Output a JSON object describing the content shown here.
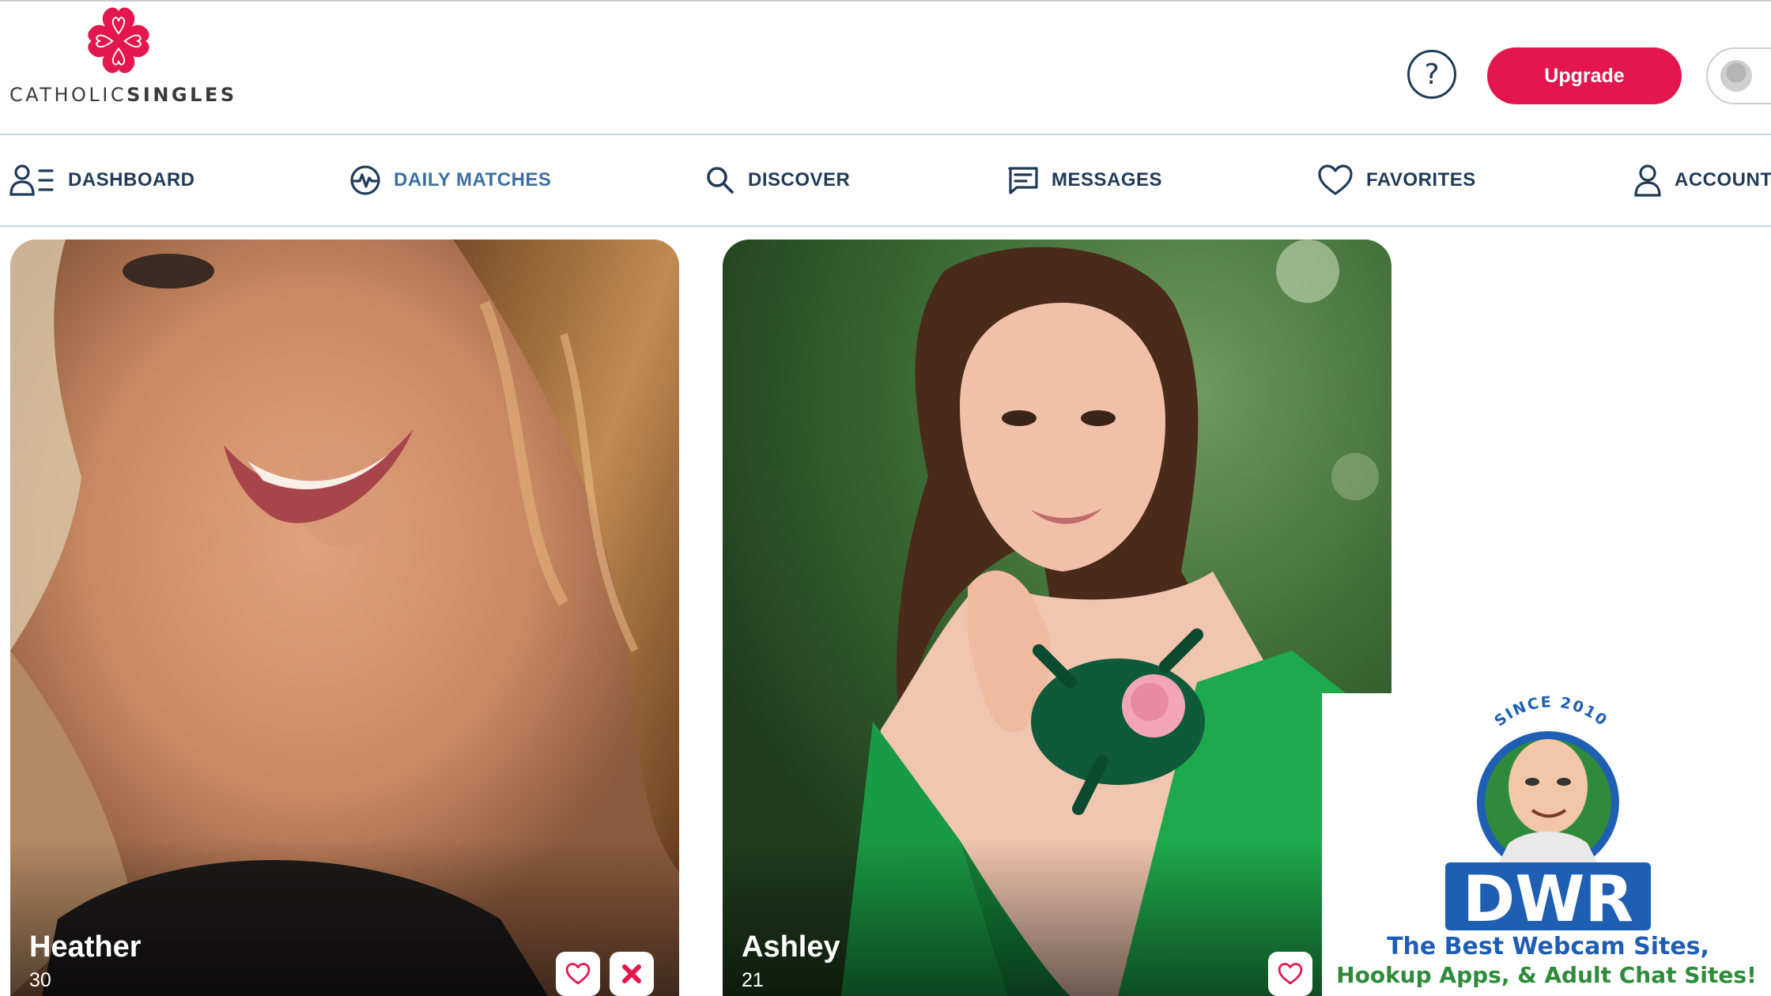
{
  "header": {
    "logo_text_light": "CATHOLIC",
    "logo_text_bold": "SINGLES",
    "help_label": "?",
    "upgrade_label": "Upgrade"
  },
  "nav": {
    "items": [
      {
        "label": "DASHBOARD",
        "icon": "dashboard-user-icon"
      },
      {
        "label": "DAILY MATCHES",
        "icon": "heartbeat-icon"
      },
      {
        "label": "DISCOVER",
        "icon": "search-icon"
      },
      {
        "label": "MESSAGES",
        "icon": "message-icon"
      },
      {
        "label": "FAVORITES",
        "icon": "heart-icon"
      },
      {
        "label": "ACCOUNT",
        "icon": "user-icon"
      }
    ]
  },
  "profiles": [
    {
      "name": "Heather",
      "age": "30",
      "actions": [
        "favorite",
        "dismiss"
      ]
    },
    {
      "name": "Ashley",
      "age": "21",
      "actions": [
        "favorite"
      ]
    }
  ],
  "watermark": {
    "since": "SINCE 2010",
    "brand": "DWR",
    "tagline_1": "The Best Webcam Sites,",
    "tagline_2": "Hookup Apps, & Adult Chat Sites!"
  },
  "colors": {
    "brand_red": "#e3174d",
    "nav_text": "#1f3b57",
    "nav_active": "#3b6fa1",
    "watermark_blue": "#1f5fb3",
    "watermark_green": "#2e8b3a"
  }
}
